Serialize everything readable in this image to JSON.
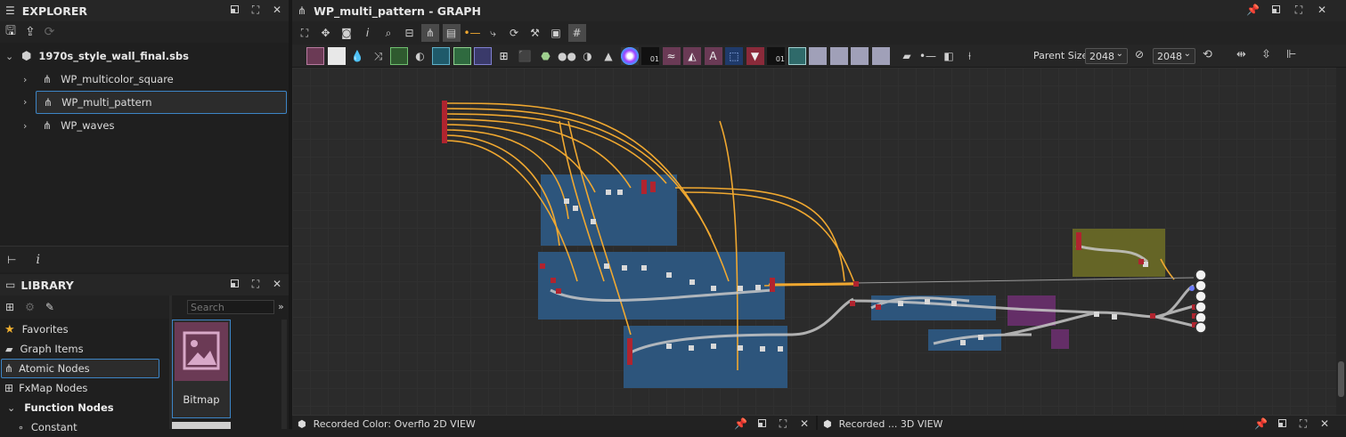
{
  "explorer": {
    "title": "EXPLORER",
    "package": "1970s_style_wall_final.sbs",
    "graphs": [
      {
        "label": "WP_multicolor_square",
        "selected": false
      },
      {
        "label": "WP_multi_pattern",
        "selected": true
      },
      {
        "label": "WP_waves",
        "selected": false
      }
    ]
  },
  "library": {
    "title": "LIBRARY",
    "search_placeholder": "Search",
    "categories": [
      {
        "label": "Favorites",
        "icon": "star-icon"
      },
      {
        "label": "Graph Items",
        "icon": "comment-icon"
      },
      {
        "label": "Atomic Nodes",
        "icon": "graph-icon",
        "selected": true
      },
      {
        "label": "FxMap Nodes",
        "icon": "grid-icon"
      },
      {
        "label": "Function Nodes",
        "icon": "chevron-down-icon",
        "bold": true
      },
      {
        "label": "Constant",
        "icon": "function-icon"
      }
    ],
    "tile": {
      "label": "Bitmap",
      "icon": "image-icon",
      "color": "#6b3a55"
    }
  },
  "graph": {
    "title": "WP_multi_pattern - GRAPH",
    "parent_size_label": "Parent Size:",
    "parent_size_value": "2048",
    "output_size_value": "2048"
  },
  "bottom_tabs": [
    {
      "label": "Recorded Color: Overflo 2D VIEW"
    },
    {
      "label": "Recorded ... 3D VIEW"
    }
  ],
  "colors": {
    "background": "#1f1f1f",
    "graph_bg": "#2a2a2a",
    "frame_blue": "#2e5a85",
    "frame_olive": "#6b6b26",
    "frame_purple": "#6a2f6e",
    "wire_orange": "#f0a830",
    "wire_gray": "#c8c8c8",
    "selection": "#3d85c6"
  }
}
